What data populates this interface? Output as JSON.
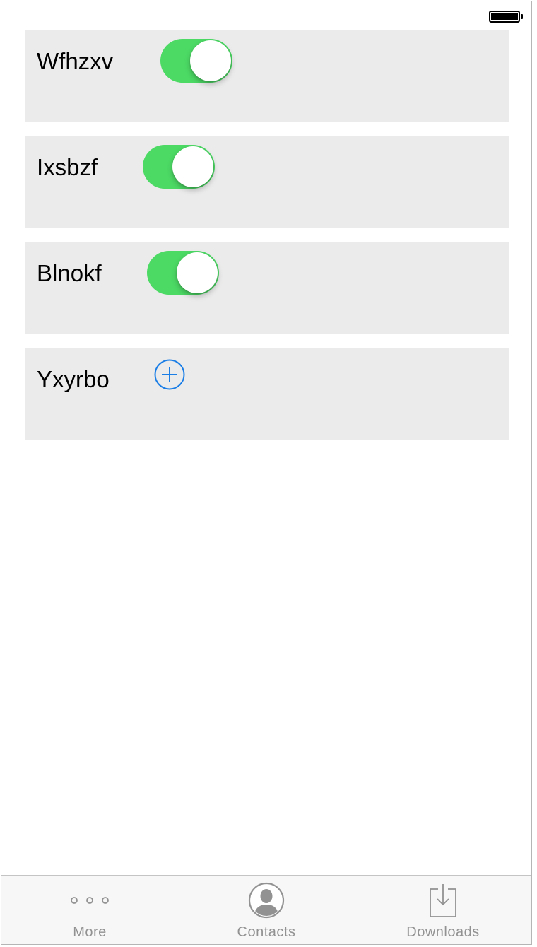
{
  "rows": [
    {
      "label": "Wfhzxv",
      "control": "toggle",
      "on": true
    },
    {
      "label": "Ixsbzf",
      "control": "toggle",
      "on": true
    },
    {
      "label": "Blnokf",
      "control": "toggle",
      "on": true
    },
    {
      "label": "Yxyrbo",
      "control": "add-button"
    }
  ],
  "tab_bar": {
    "tabs": [
      {
        "label": "More",
        "icon": "more-icon"
      },
      {
        "label": "Contacts",
        "icon": "contacts-icon"
      },
      {
        "label": "Downloads",
        "icon": "downloads-icon"
      }
    ]
  },
  "colors": {
    "toggle_on": "#4cd964",
    "accent": "#1a7ee6",
    "row_background": "#ebebeb",
    "tab_label": "#929292"
  }
}
